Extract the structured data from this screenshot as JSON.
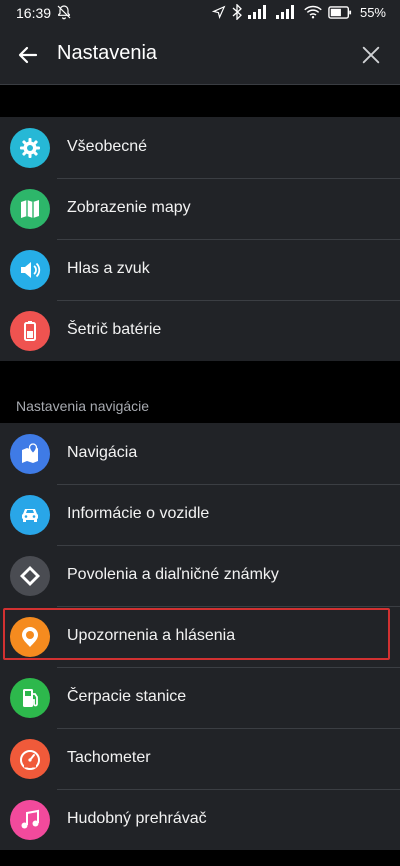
{
  "status_bar": {
    "time": "16:39",
    "battery_percent": "55%",
    "icons": [
      "muted-bell-icon",
      "location-arrow-icon",
      "bluetooth-icon",
      "signal-icon",
      "signal-icon",
      "wifi-icon",
      "battery-icon"
    ]
  },
  "appbar": {
    "title": "Nastavenia",
    "back_icon": "arrow-left-icon",
    "close_icon": "close-icon"
  },
  "group1": [
    {
      "label": "Všeobecné",
      "icon": "gear-icon",
      "color": "#26b8d6"
    },
    {
      "label": "Zobrazenie mapy",
      "icon": "map-icon",
      "color": "#2db66a"
    },
    {
      "label": "Hlas a zvuk",
      "icon": "speaker-icon",
      "color": "#26aee8"
    },
    {
      "label": "Šetrič batérie",
      "icon": "battery-icon",
      "color": "#ef5350"
    }
  ],
  "navigation_section": {
    "title": "Nastavenia navigácie",
    "items": [
      {
        "label": "Navigácia",
        "icon": "map-pin-icon",
        "color": "#3f7be6"
      },
      {
        "label": "Informácie o vozidle",
        "icon": "car-icon",
        "color": "#29a6e8"
      },
      {
        "label": "Povolenia a diaľničné známky",
        "icon": "road-sign-icon",
        "color": "#4a4c52"
      },
      {
        "label": "Upozornenia a hlásenia",
        "icon": "alert-pin-icon",
        "color": "#f58b1f",
        "highlighted": true
      },
      {
        "label": "Čerpacie stanice",
        "icon": "fuel-pump-icon",
        "color": "#2db84c"
      },
      {
        "label": "Tachometer",
        "icon": "speedometer-icon",
        "color": "#f05a3a"
      },
      {
        "label": "Hudobný prehrávač",
        "icon": "music-note-icon",
        "color": "#f24a9c"
      }
    ]
  }
}
